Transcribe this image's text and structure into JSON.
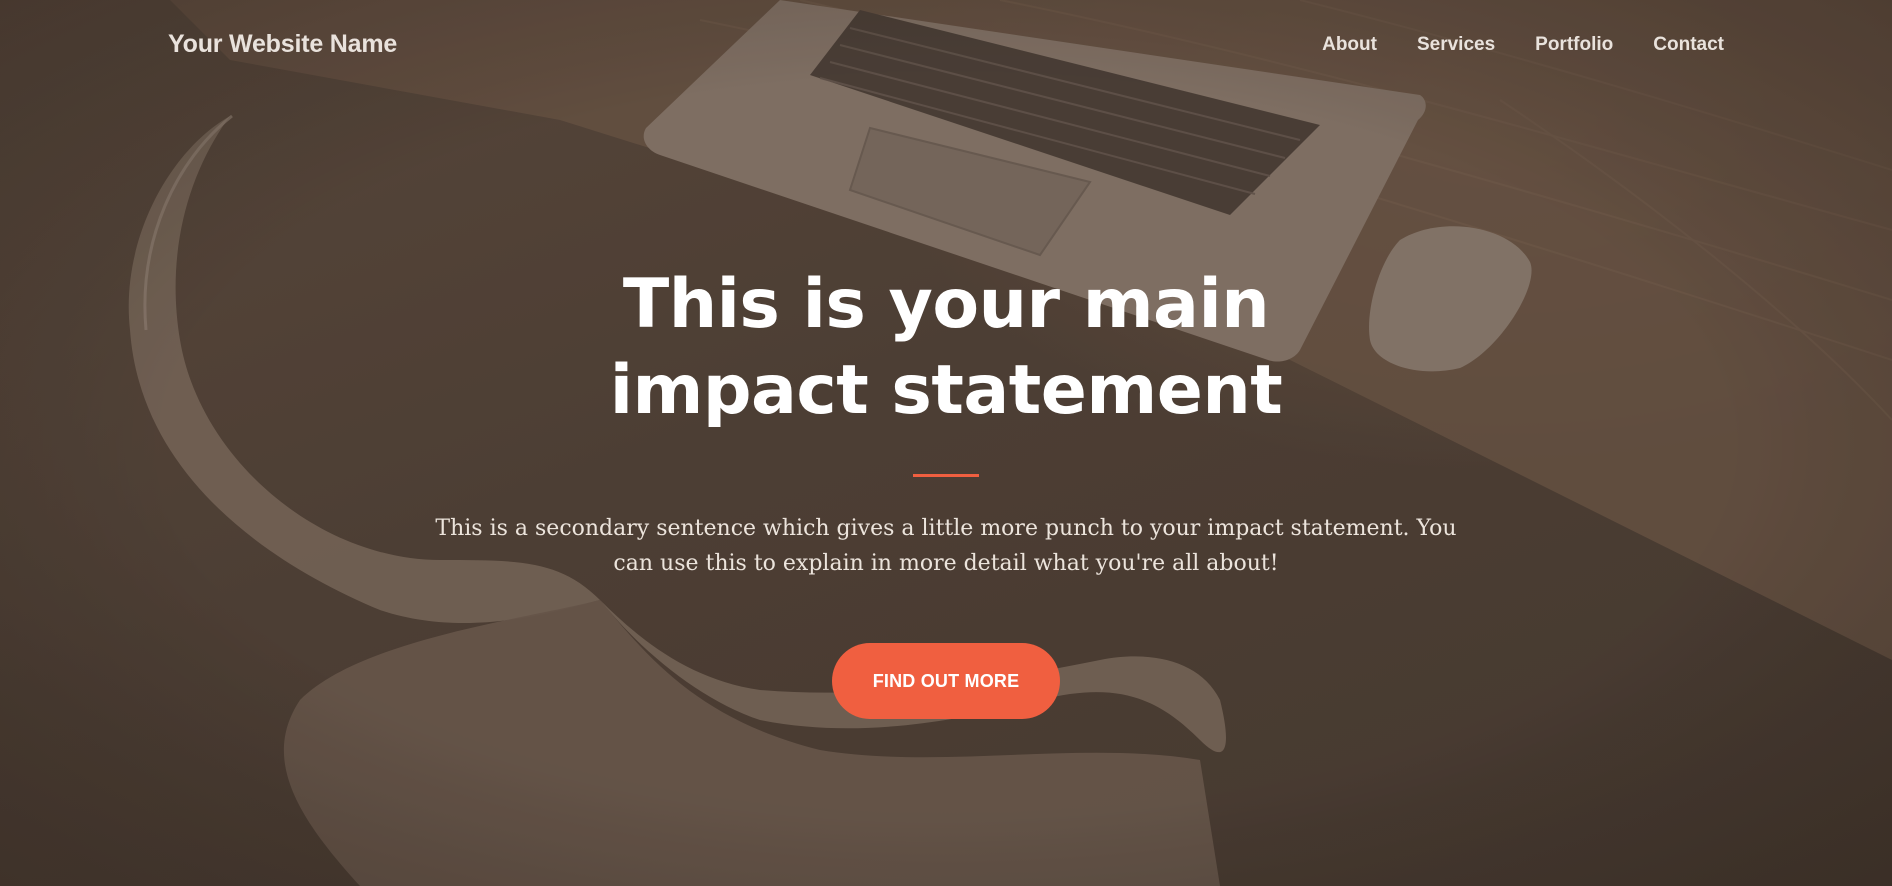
{
  "navbar": {
    "brand": "Your Website Name",
    "links": [
      {
        "label": "About"
      },
      {
        "label": "Services"
      },
      {
        "label": "Portfolio"
      },
      {
        "label": "Contact"
      }
    ]
  },
  "hero": {
    "headline": "This is your main impact statement",
    "subtext": "This is a secondary sentence which gives a little more punch to your impact statement. You can use this to explain in more detail what you're all about!",
    "cta_label": "FIND OUT MORE",
    "background_image": "laptop-desk-chair-photo"
  },
  "colors": {
    "accent": "#f05f40",
    "overlay": "#4d3f36",
    "text": "#ffffff"
  }
}
